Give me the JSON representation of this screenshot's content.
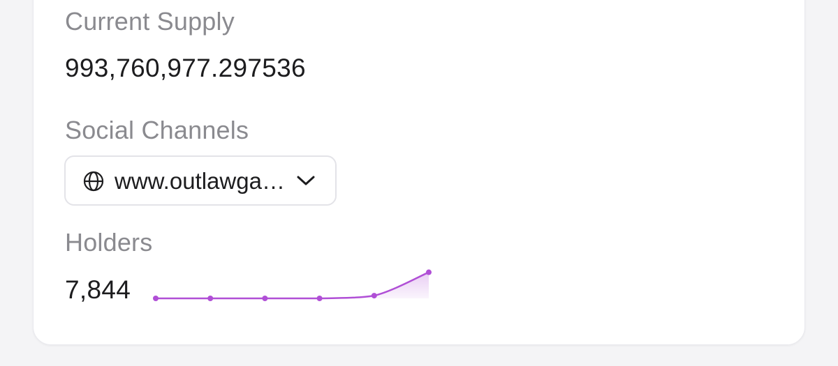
{
  "token_info": {
    "current_supply": {
      "label": "Current Supply",
      "value": "993,760,977.297536"
    },
    "social_channels": {
      "label": "Social Channels",
      "selected": "www.outlawga…",
      "icon": "globe-icon",
      "dropdown_icon": "chevron-down-icon"
    },
    "holders": {
      "label": "Holders",
      "value": "7,844",
      "trend": [
        0,
        0,
        0,
        0,
        0.1,
        0.96
      ],
      "accent": "#b04fd6"
    }
  }
}
